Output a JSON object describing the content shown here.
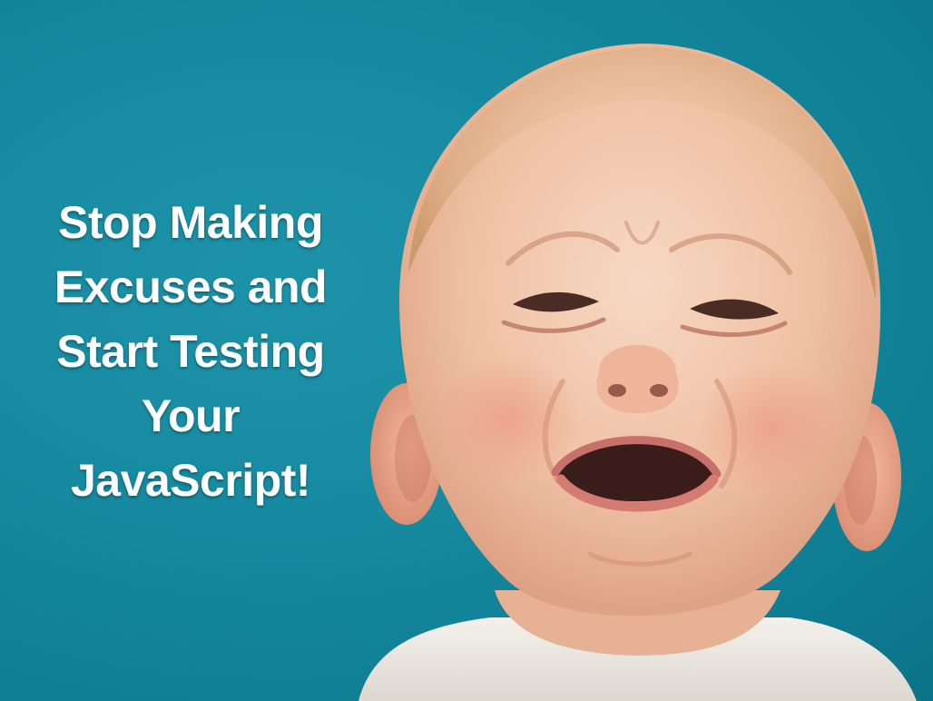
{
  "slide": {
    "headline_lines": [
      "Stop Making",
      "Excuses and",
      "Start Testing",
      "Your",
      "JavaScript!"
    ]
  },
  "colors": {
    "background": "#168aa0",
    "text": "#ffffff",
    "skin": "#f2c7ac"
  }
}
